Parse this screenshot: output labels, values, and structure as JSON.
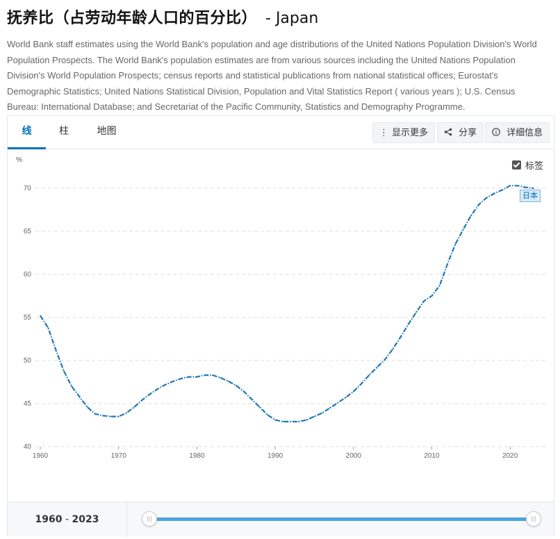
{
  "header": {
    "title": "抚养比（占劳动年龄人口的百分比）",
    "country": "- Japan",
    "description": "World Bank staff estimates using the World Bank's population and age distributions of the United Nations Population Division's World Population Prospects. The World Bank's population estimates are from various sources including the United Nations Population Division's World Population Prospects; census reports and statistical publications from national statistical offices; Eurostat's Demographic Statistics; United Nations Statistical Division, Population and Vital Statistics Report ( various years ); U.S. Census Bureau: International Database; and Secretariat of the Pacific Community, Statistics and Demography Programme."
  },
  "tabs": [
    {
      "label": "线",
      "active": true
    },
    {
      "label": "柱",
      "active": false
    },
    {
      "label": "地图",
      "active": false
    }
  ],
  "toolbar": {
    "more_label": "显示更多",
    "share_label": "分享",
    "details_label": "详细信息",
    "more_icon": "vertical-dots-icon",
    "share_icon": "share-icon",
    "details_icon": "info-icon"
  },
  "labels_toggle": {
    "label": "标签",
    "checked": true
  },
  "footer": {
    "range_start": "1960",
    "range_sep": " - ",
    "range_end": "2023"
  },
  "colors": {
    "accent": "#0071bc",
    "line": "#1f77b4",
    "slider": "#4da3dc"
  },
  "chart_data": {
    "type": "line",
    "ylabel": "%",
    "ylim": [
      40,
      70
    ],
    "xlim": [
      1960,
      2023
    ],
    "yticks": [
      40,
      45,
      50,
      55,
      60,
      65,
      70
    ],
    "xticks": [
      1960,
      1970,
      1980,
      1990,
      2000,
      2010,
      2020
    ],
    "grid": true,
    "series": [
      {
        "name": "日本",
        "x": [
          1960,
          1961,
          1962,
          1963,
          1964,
          1965,
          1966,
          1967,
          1968,
          1969,
          1970,
          1971,
          1972,
          1973,
          1974,
          1975,
          1976,
          1977,
          1978,
          1979,
          1980,
          1981,
          1982,
          1983,
          1984,
          1985,
          1986,
          1987,
          1988,
          1989,
          1990,
          1991,
          1992,
          1993,
          1994,
          1995,
          1996,
          1997,
          1998,
          1999,
          2000,
          2001,
          2002,
          2003,
          2004,
          2005,
          2006,
          2007,
          2008,
          2009,
          2010,
          2011,
          2012,
          2013,
          2014,
          2015,
          2016,
          2017,
          2018,
          2019,
          2020,
          2021,
          2022,
          2023
        ],
        "values": [
          55.2,
          53.8,
          51.2,
          48.8,
          47.0,
          45.8,
          44.6,
          43.8,
          43.6,
          43.5,
          43.5,
          43.9,
          44.6,
          45.4,
          46.1,
          46.7,
          47.2,
          47.6,
          47.9,
          48.1,
          48.1,
          48.3,
          48.3,
          48.0,
          47.6,
          47.1,
          46.4,
          45.5,
          44.6,
          43.7,
          43.1,
          42.9,
          42.9,
          42.9,
          43.1,
          43.5,
          43.9,
          44.5,
          45.1,
          45.7,
          46.4,
          47.3,
          48.3,
          49.2,
          50.1,
          51.3,
          52.7,
          54.2,
          55.6,
          56.9,
          57.5,
          58.7,
          61.2,
          63.5,
          65.2,
          66.8,
          68.1,
          68.9,
          69.4,
          69.8,
          70.3,
          70.3,
          70.1,
          70.0
        ]
      }
    ]
  }
}
